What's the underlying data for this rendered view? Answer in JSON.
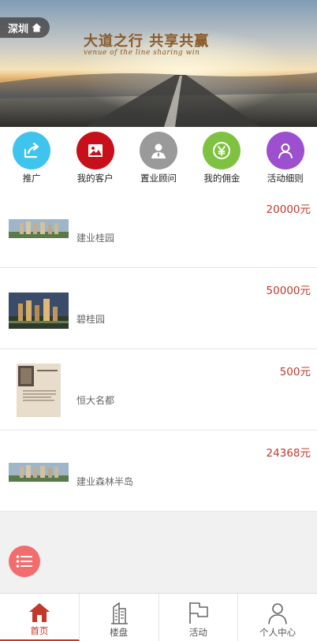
{
  "banner": {
    "city": "深圳",
    "slogan_cn": "大道之行 共享共赢",
    "slogan_en": "venue of the line    sharing win"
  },
  "shortcuts": [
    {
      "label": "推广",
      "icon": "share-arrow-icon",
      "color": "#3fc4ee"
    },
    {
      "label": "我的客户",
      "icon": "picture-icon",
      "color": "#c8101a"
    },
    {
      "label": "置业顾问",
      "icon": "consultant-icon",
      "color": "#9a9a9a"
    },
    {
      "label": "我的佣金",
      "icon": "yen-icon",
      "color": "#7fc241"
    },
    {
      "label": "活动细则",
      "icon": "user-icon",
      "color": "#9c4fce"
    }
  ],
  "listings": [
    {
      "price": "20000元",
      "name": "建业桂园"
    },
    {
      "price": "50000元",
      "name": "碧桂园"
    },
    {
      "price": "500元",
      "name": "恒大名都"
    },
    {
      "price": "24368元",
      "name": "建业森林半岛"
    }
  ],
  "fab": {
    "icon": "menu-list-icon",
    "color": "#f26d6d"
  },
  "tabbar": {
    "items": [
      {
        "label": "首页",
        "icon": "home-icon",
        "active": true
      },
      {
        "label": "楼盘",
        "icon": "building-icon",
        "active": false
      },
      {
        "label": "活动",
        "icon": "flag-icon",
        "active": false
      },
      {
        "label": "个人中心",
        "icon": "person-icon",
        "active": false
      }
    ],
    "accent": "#c0392b"
  }
}
